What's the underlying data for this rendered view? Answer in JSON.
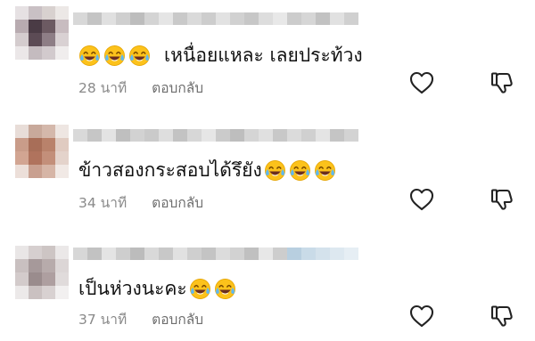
{
  "comments": [
    {
      "text": "เหนื่อยแหละ เลยประท้วง",
      "emoji_count": 3,
      "emoji_position": "before",
      "time": "28 นาที",
      "reply_label": "ตอบกลับ",
      "avatar_pixels": [
        "#e6e1e3",
        "#c9c0c4",
        "#d8d1cf",
        "#ece8e6",
        "#b8abb0",
        "#4a3b45",
        "#6c5a62",
        "#c8bcc0",
        "#d4ccce",
        "#5c4b55",
        "#8e7e86",
        "#d9d1d3",
        "#ebe7e8",
        "#c4bbbf",
        "#d2cacd",
        "#f0eded"
      ],
      "username_pixels": [
        "#d8d8d8",
        "#c4c4c4",
        "#e0e0e0",
        "#cfcfcf",
        "#bdbdbd",
        "#d4d4d4",
        "#e5e5e5",
        "#c9c9c9",
        "#dadada",
        "#cdcdcd",
        "#e2e2e2",
        "#d1d1d1",
        "#c7c7c7",
        "#dddddd",
        "#e8e8e8",
        "#cccccc",
        "#d6d6d6",
        "#c2c2c2",
        "#e1e1e1",
        "#d0d0d0"
      ]
    },
    {
      "text": "ข้าวสองกระสอบได้รึยัง",
      "emoji_count": 3,
      "emoji_position": "after",
      "time": "34 นาที",
      "reply_label": "ตอบกลับ",
      "avatar_pixels": [
        "#e8ddd8",
        "#c8a99b",
        "#d4b8ab",
        "#eee6e2",
        "#c99c89",
        "#a86e58",
        "#b9826b",
        "#e0cbc1",
        "#d2a592",
        "#b0735d",
        "#c38f7a",
        "#e4d3cb",
        "#ecdfd9",
        "#c9a090",
        "#d6b5a6",
        "#f1e9e5"
      ],
      "username_pixels": [
        "#d9d9d9",
        "#c6c6c6",
        "#e3e3e3",
        "#bfbfbf",
        "#d2d2d2",
        "#cacaca",
        "#dedede",
        "#c3c3c3",
        "#d7d7d7",
        "#e6e6e6",
        "#cbcbcb",
        "#bebebe",
        "#d5d5d5",
        "#e0e0e0",
        "#c8c8c8",
        "#dbdbdb",
        "#d0d0d0",
        "#e4e4e4",
        "#c5c5c5",
        "#d3d3d3"
      ]
    },
    {
      "text": "เป็นห่วงนะคะ",
      "emoji_count": 2,
      "emoji_position": "after",
      "time": "37 นาที",
      "reply_label": "ตอบกลับ",
      "avatar_pixels": [
        "#e9e6e6",
        "#d6cfcf",
        "#cdc5c4",
        "#ebe8e8",
        "#c9c0c0",
        "#a6999a",
        "#b7abab",
        "#dcd6d6",
        "#d3cbcb",
        "#9a8c8d",
        "#ae9fa0",
        "#e0dbdb",
        "#ece9e9",
        "#cac1c1",
        "#d8d1d1",
        "#f2f0f0"
      ],
      "username_pixels": [
        "#d7d7d7",
        "#c2c2c2",
        "#e4e4e4",
        "#cecece",
        "#bcbcbc",
        "#d9d9d9",
        "#c8c8c8",
        "#e1e1e1",
        "#cfcfcf",
        "#c4c4c4",
        "#dcdcdc",
        "#d2d2d2",
        "#c0c0c0",
        "#e7e7e7",
        "#cdcdcd",
        "#b8cfe0",
        "#c9dbe8",
        "#d4e2ec",
        "#dde8f0",
        "#e6eef4"
      ]
    }
  ],
  "icons": {
    "like": "heart-outline-icon",
    "dislike": "thumbs-down-outline-icon",
    "emoji": "face-with-tears-of-joy"
  },
  "colors": {
    "text": "#111111",
    "meta": "#8a8a8a",
    "icon": "#222222",
    "emoji_face": "#fcc21b",
    "emoji_tear": "#5fb8f2"
  }
}
